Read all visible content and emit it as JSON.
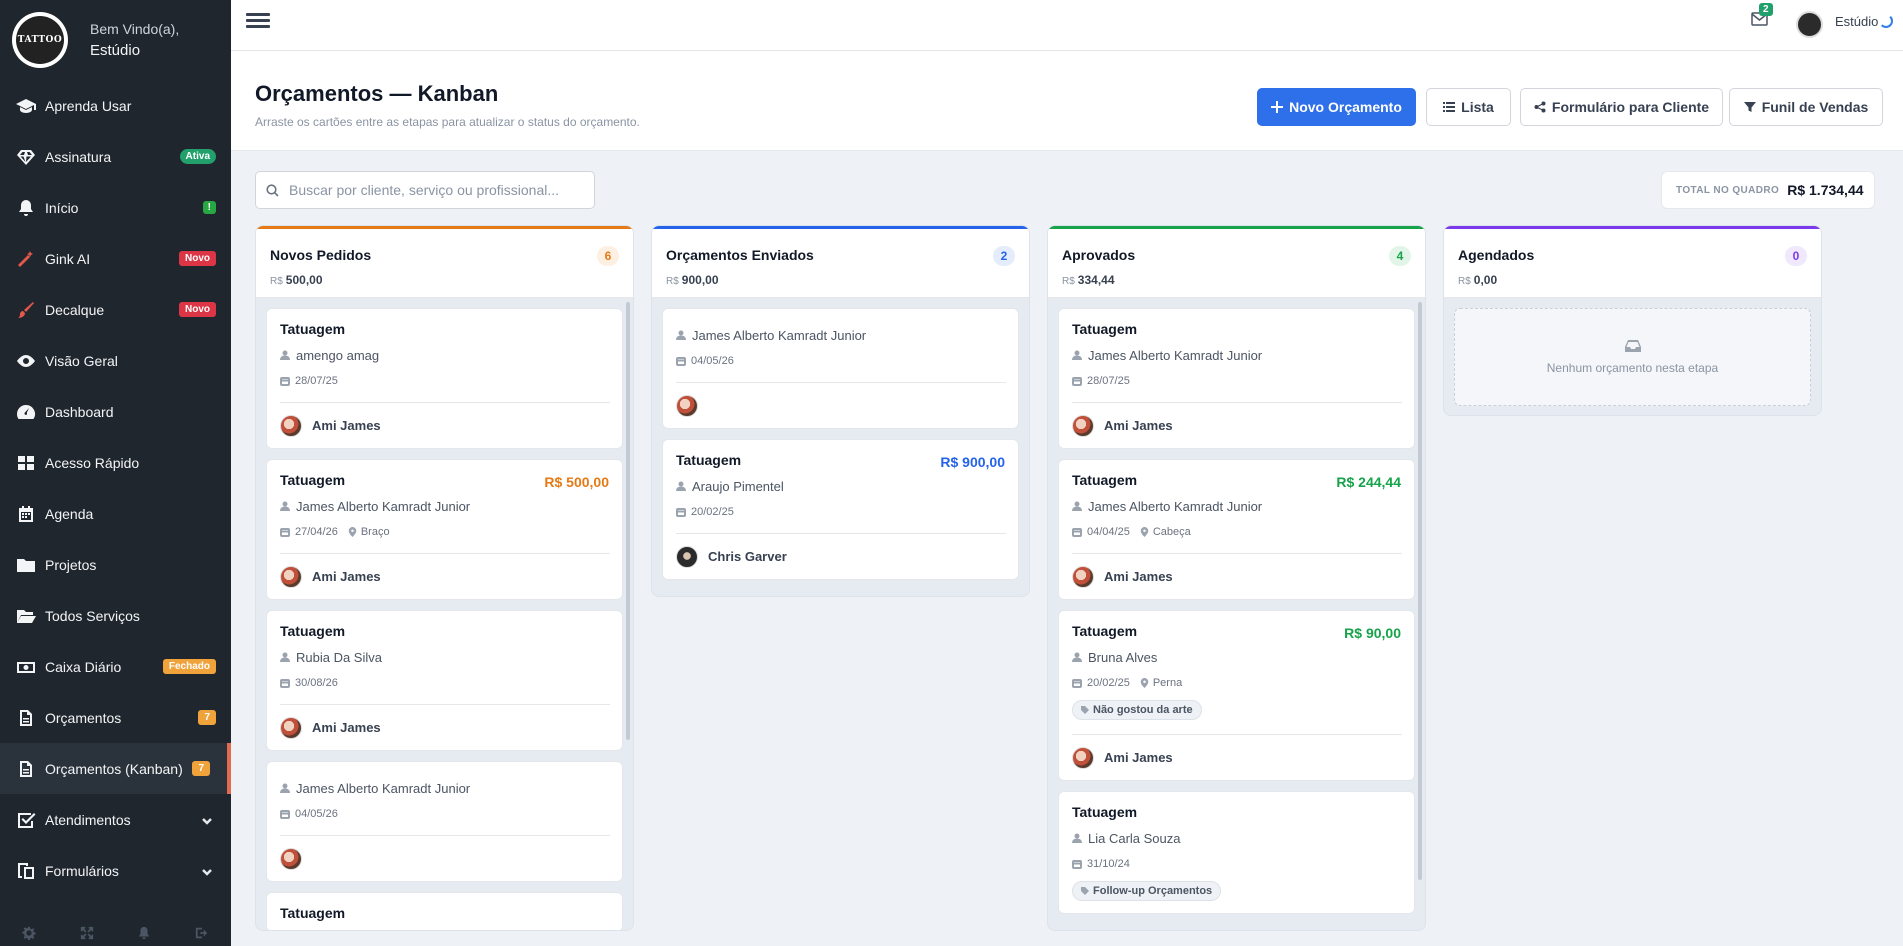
{
  "sidebar": {
    "logo_text": "TATTOO",
    "welcome": "Bem Vindo(a),",
    "studio": "Estúdio",
    "items": [
      {
        "label": "Aprenda Usar",
        "icon": "graduation-cap-icon"
      },
      {
        "label": "Assinatura",
        "icon": "diamond-icon",
        "badge": "Ativa"
      },
      {
        "label": "Início",
        "icon": "bell-icon",
        "badge": "!"
      },
      {
        "label": "Gink AI",
        "icon": "magic-wand-icon",
        "badge": "Novo"
      },
      {
        "label": "Decalque",
        "icon": "brush-icon",
        "badge": "Novo"
      },
      {
        "label": "Visão Geral",
        "icon": "eye-icon"
      },
      {
        "label": "Dashboard",
        "icon": "gauge-icon"
      },
      {
        "label": "Acesso Rápido",
        "icon": "grid-icon"
      },
      {
        "label": "Agenda",
        "icon": "calendar-icon"
      },
      {
        "label": "Projetos",
        "icon": "folder-icon"
      },
      {
        "label": "Todos Serviços",
        "icon": "folder-open-icon"
      },
      {
        "label": "Caixa Diário",
        "icon": "money-icon",
        "badge": "Fechado"
      },
      {
        "label": "Orçamentos",
        "icon": "file-icon",
        "badge": "7"
      },
      {
        "label": "Orçamentos (Kanban)",
        "icon": "file-icon",
        "badge": "7"
      },
      {
        "label": "Atendimentos",
        "icon": "check-square-icon"
      },
      {
        "label": "Formulários",
        "icon": "copy-icon"
      }
    ]
  },
  "topbar": {
    "mail_count": "2",
    "user_name": "Estúdio"
  },
  "header": {
    "title": "Orçamentos — Kanban",
    "subtitle": "Arraste os cartões entre as etapas para atualizar o status do orçamento.",
    "btn_new": "Novo Orçamento",
    "btn_list": "Lista",
    "btn_form": "Formulário para Cliente",
    "btn_funnel": "Funil de Vendas"
  },
  "filters": {
    "search_placeholder": "Buscar por cliente, serviço ou profissional...",
    "total_label": "TOTAL NO QUADRO",
    "total_value": "R$ 1.734,44"
  },
  "colors": {
    "novos": "#e47b16",
    "enviados": "#2563eb",
    "aprovados": "#16a34a",
    "agendados": "#7c3aed"
  },
  "columns": [
    {
      "title": "Novos Pedidos",
      "count": "6",
      "currency": "R$",
      "total": "500,00",
      "cards": [
        {
          "title": "Tatuagem",
          "value": "",
          "client": "amengo amag",
          "date": "28/07/25",
          "location": "",
          "tag": "",
          "artist": "Ami James"
        },
        {
          "title": "Tatuagem",
          "value": "R$ 500,00",
          "client": "James Alberto Kamradt Junior",
          "date": "27/04/26",
          "location": "Braço",
          "tag": "",
          "artist": "Ami James"
        },
        {
          "title": "Tatuagem",
          "value": "",
          "client": "Rubia Da Silva",
          "date": "30/08/26",
          "location": "",
          "tag": "",
          "artist": "Ami James"
        },
        {
          "title": "",
          "value": "",
          "client": "James Alberto Kamradt Junior",
          "date": "04/05/26",
          "location": "",
          "tag": "",
          "artist": ""
        },
        {
          "title": "Tatuagem",
          "value": "",
          "client": "",
          "date": "",
          "location": "",
          "tag": "",
          "artist": ""
        }
      ]
    },
    {
      "title": "Orçamentos Enviados",
      "count": "2",
      "currency": "R$",
      "total": "900,00",
      "cards": [
        {
          "title": "",
          "value": "",
          "client": "James Alberto Kamradt Junior",
          "date": "04/05/26",
          "location": "",
          "tag": "",
          "artist": ""
        },
        {
          "title": "Tatuagem",
          "value": "R$ 900,00",
          "client": "Araujo Pimentel",
          "date": "20/02/25",
          "location": "",
          "tag": "",
          "artist": "Chris Garver"
        }
      ]
    },
    {
      "title": "Aprovados",
      "count": "4",
      "currency": "R$",
      "total": "334,44",
      "cards": [
        {
          "title": "Tatuagem",
          "value": "",
          "client": "James Alberto Kamradt Junior",
          "date": "28/07/25",
          "location": "",
          "tag": "",
          "artist": "Ami James"
        },
        {
          "title": "Tatuagem",
          "value": "R$ 244,44",
          "client": "James Alberto Kamradt Junior",
          "date": "04/04/25",
          "location": "Cabeça",
          "tag": "",
          "artist": "Ami James"
        },
        {
          "title": "Tatuagem",
          "value": "R$ 90,00",
          "client": "Bruna Alves",
          "date": "20/02/25",
          "location": "Perna",
          "tag": "Não gostou da arte",
          "artist": "Ami James"
        },
        {
          "title": "Tatuagem",
          "value": "",
          "client": "Lia Carla Souza",
          "date": "31/10/24",
          "location": "",
          "tag": "Follow-up Orçamentos",
          "artist": ""
        }
      ]
    },
    {
      "title": "Agendados",
      "count": "0",
      "currency": "R$",
      "total": "0,00",
      "empty_text": "Nenhum orçamento nesta etapa"
    }
  ]
}
